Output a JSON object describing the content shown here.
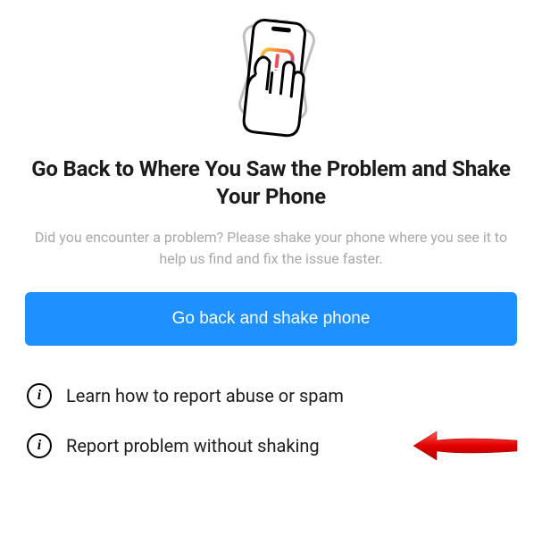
{
  "title": "Go Back to Where You Saw the Problem and Shake Your Phone",
  "description": "Did you encounter a problem? Please shake your phone where you see it to help us find and fix the issue faster.",
  "primary_button": "Go back and shake phone",
  "options": [
    {
      "label": "Learn how to report abuse or spam"
    },
    {
      "label": "Report problem without shaking"
    }
  ],
  "illustration": "phone-shake-report-icon",
  "annotation": "red-arrow-pointing-left"
}
